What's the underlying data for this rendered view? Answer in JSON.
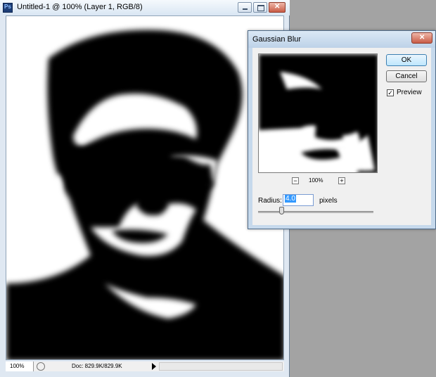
{
  "document": {
    "title": "Untitled-1 @ 100% (Layer 1, RGB/8)",
    "zoom": "100%",
    "doc_info": "Doc: 829.9K/829.9K"
  },
  "dialog": {
    "title": "Gaussian Blur",
    "ok_label": "OK",
    "cancel_label": "Cancel",
    "preview_label": "Preview",
    "preview_checked": true,
    "preview_zoom": "100%",
    "radius_label": "Radius:",
    "radius_value": "4.0",
    "radius_unit": "pixels"
  },
  "colors": {
    "workspace": "#a3a3a3",
    "window_frame": "#c6d9ec",
    "ok_button": "#bee6fd"
  }
}
